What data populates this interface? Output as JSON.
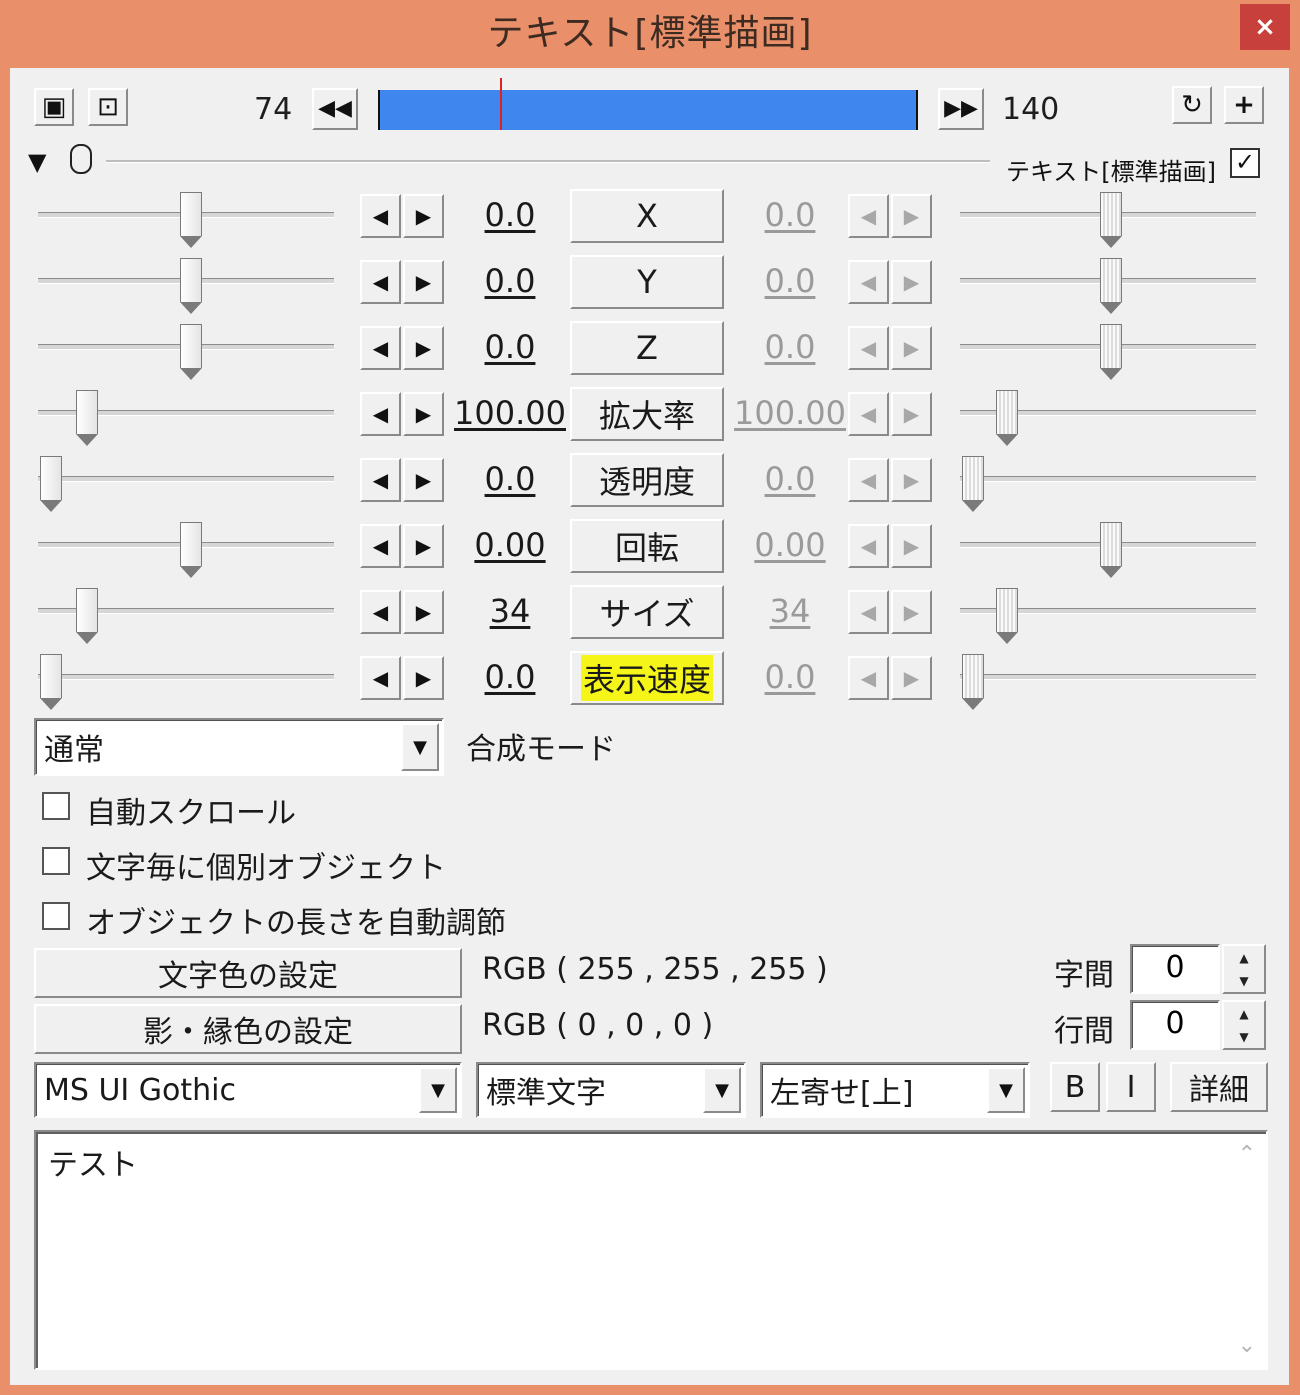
{
  "window": {
    "title": "テキスト[標準描画]",
    "close_label": "×"
  },
  "timeline": {
    "start_frame": "74",
    "end_frame": "140",
    "prev_label": "◀◀",
    "next_label": "▶▶",
    "loop_icon": "↻",
    "add_label": "+"
  },
  "filter_header": {
    "name": "テキスト[標準描画]",
    "enabled": true
  },
  "params": [
    {
      "label": "X",
      "start": "0.0",
      "end": "0.0",
      "highlight": false
    },
    {
      "label": "Y",
      "start": "0.0",
      "end": "0.0",
      "highlight": false
    },
    {
      "label": "Z",
      "start": "0.0",
      "end": "0.0",
      "highlight": false
    },
    {
      "label": "拡大率",
      "start": "100.00",
      "end": "100.00",
      "highlight": false
    },
    {
      "label": "透明度",
      "start": "0.0",
      "end": "0.0",
      "highlight": false
    },
    {
      "label": "回転",
      "start": "0.00",
      "end": "0.00",
      "highlight": false
    },
    {
      "label": "サイズ",
      "start": "34",
      "end": "34",
      "highlight": false
    },
    {
      "label": "表示速度",
      "start": "0.0",
      "end": "0.0",
      "highlight": true
    }
  ],
  "blend": {
    "value": "通常",
    "label": "合成モード"
  },
  "checkboxes": [
    {
      "label": "自動スクロール",
      "checked": false
    },
    {
      "label": "文字毎に個別オブジェクト",
      "checked": false
    },
    {
      "label": "オブジェクトの長さを自動調節",
      "checked": false
    }
  ],
  "colors": {
    "text_color_button": "文字色の設定",
    "text_color_value": "RGB ( 255 , 255 , 255 )",
    "shadow_color_button": "影・縁色の設定",
    "shadow_color_value": "RGB ( 0 , 0 , 0 )"
  },
  "spacing": {
    "char_label": "字間",
    "char_value": "0",
    "line_label": "行間",
    "line_value": "0"
  },
  "font": {
    "family": "MS UI Gothic",
    "style": "標準文字",
    "align": "左寄せ[上]",
    "bold_label": "B",
    "italic_label": "I",
    "detail_label": "詳細"
  },
  "text_content": "テスト",
  "accent_colors": {
    "title_bar": "#e9906a",
    "close_button": "#c7403b",
    "seek_bar": "#3f86ee",
    "highlight": "#f5f51a"
  }
}
